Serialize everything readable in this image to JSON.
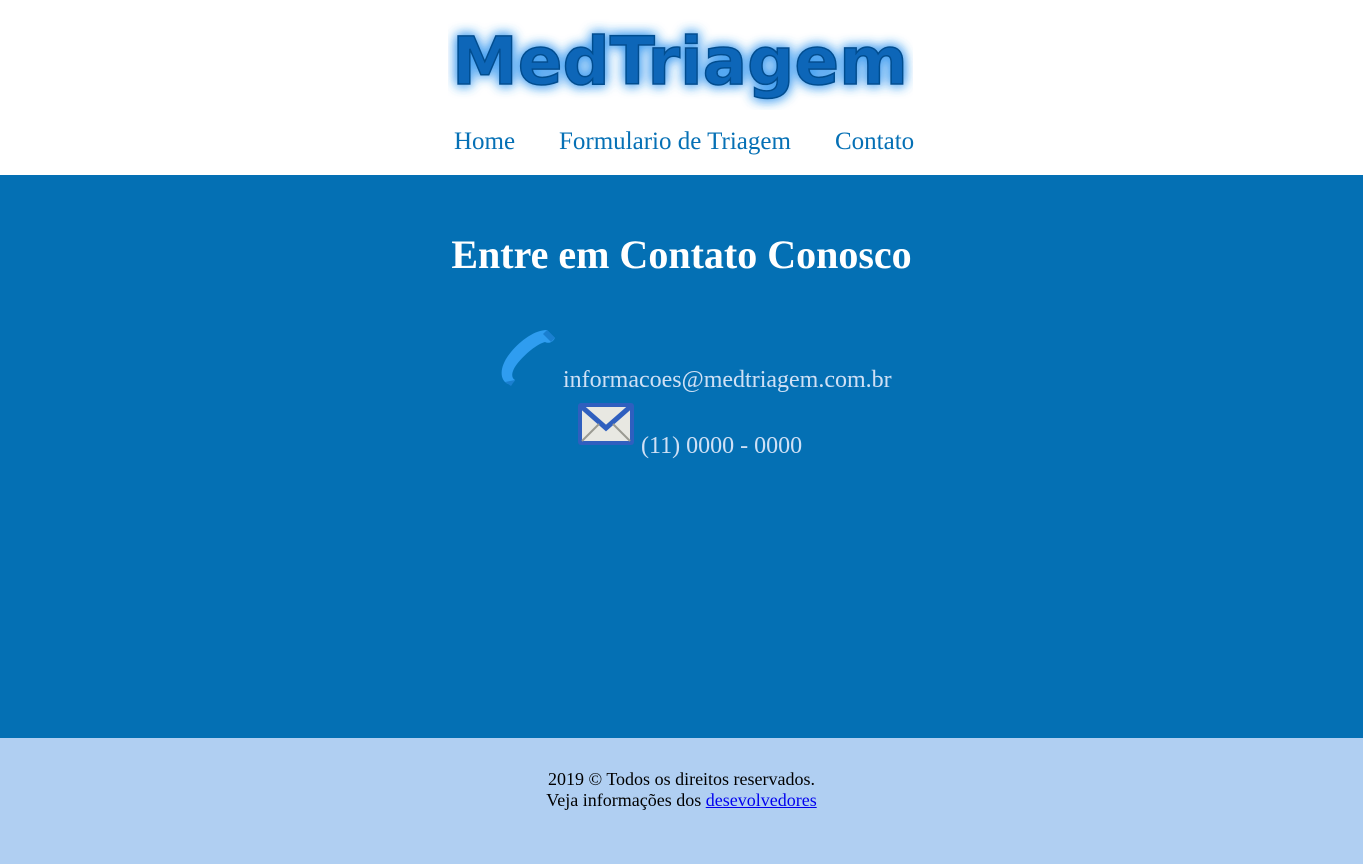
{
  "header": {
    "logo_text": "MedTriagem",
    "nav": {
      "home": "Home",
      "form": "Formulario de Triagem",
      "contact": "Contato"
    }
  },
  "main": {
    "title": "Entre em Contato Conosco",
    "email": "informacoes@medtriagem.com.br",
    "phone": "(11) 0000 - 0000"
  },
  "footer": {
    "copyright": "2019 © Todos os direitos reservados.",
    "devs_prefix": "Veja informações dos ",
    "devs_link": "desevolvedores"
  },
  "colors": {
    "brand_blue": "#0470b4",
    "nav_link": "#0570b5",
    "footer_bg": "#b0cff2",
    "contact_text": "#cfe0f5"
  },
  "icons": {
    "phone": "phone-icon",
    "mail": "mail-icon"
  }
}
